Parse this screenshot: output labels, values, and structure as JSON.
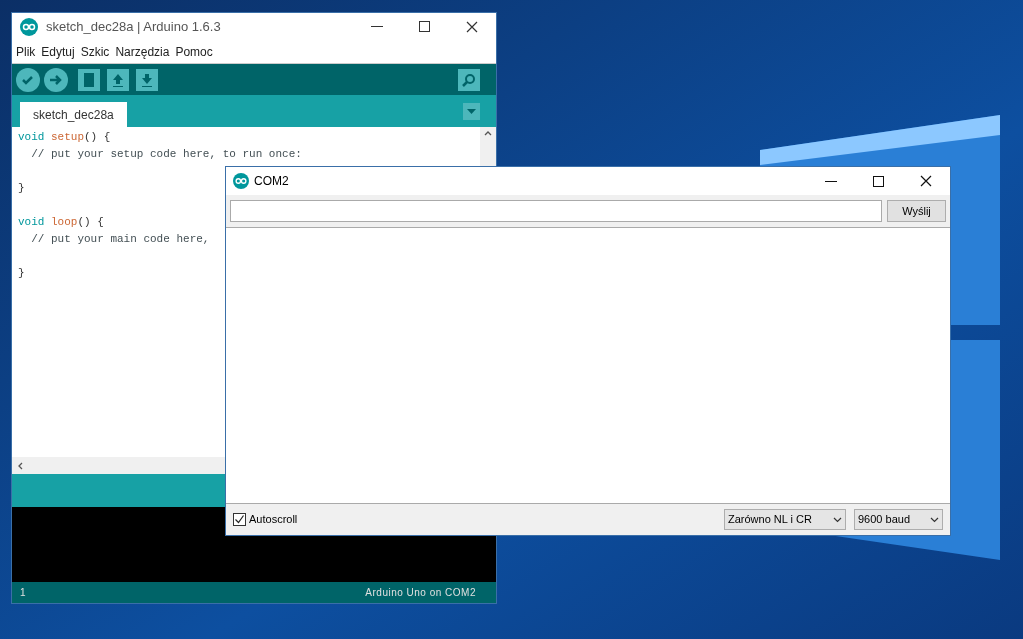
{
  "editor_window": {
    "title": "sketch_dec28a | Arduino 1.6.3",
    "menu": [
      "Plik",
      "Edytuj",
      "Szkic",
      "Narzędzia",
      "Pomoc"
    ],
    "tabs": [
      {
        "label": "sketch_dec28a",
        "selected": true
      }
    ],
    "code_lines": [
      {
        "kind": "code",
        "segments": [
          {
            "text": "void",
            "kind": "keyword"
          },
          {
            "text": " setup",
            "kind": "function"
          },
          {
            "text": "() {",
            "kind": "plain"
          }
        ]
      },
      {
        "kind": "code",
        "segments": [
          {
            "text": "  // put your setup code here, to run once:",
            "kind": "comment"
          }
        ]
      },
      {
        "kind": "blank"
      },
      {
        "kind": "code",
        "segments": [
          {
            "text": "}",
            "kind": "plain"
          }
        ]
      },
      {
        "kind": "blank"
      },
      {
        "kind": "code",
        "segments": [
          {
            "text": "void",
            "kind": "keyword"
          },
          {
            "text": " loop",
            "kind": "function"
          },
          {
            "text": "() {",
            "kind": "plain"
          }
        ]
      },
      {
        "kind": "code",
        "segments": [
          {
            "text": "  // put your main code here,",
            "kind": "comment"
          }
        ]
      },
      {
        "kind": "blank"
      },
      {
        "kind": "code",
        "segments": [
          {
            "text": "}",
            "kind": "plain"
          }
        ]
      }
    ],
    "status_bar": {
      "line": "1",
      "board": "Arduino Uno on COM2"
    }
  },
  "serial_monitor": {
    "title": "COM2",
    "send_button": "Wyślij",
    "autoscroll": {
      "label": "Autoscroll",
      "checked": true
    },
    "line_ending": "Zarówno NL i CR",
    "baud_rate": "9600 baud"
  }
}
